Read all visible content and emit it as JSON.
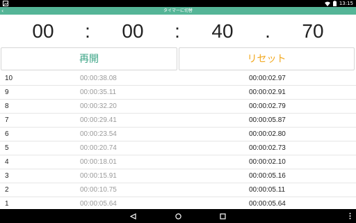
{
  "status_bar": {
    "time": "13:15"
  },
  "app_bar": {
    "title": "タイマーに切替"
  },
  "timer": {
    "hours": "00",
    "sep1": ":",
    "minutes": "00",
    "sep2": ":",
    "seconds": "40",
    "sep3": ".",
    "hundredths": "70"
  },
  "buttons": {
    "resume": "再開",
    "reset": "リセット"
  },
  "laps": [
    {
      "no": "10",
      "total": "00:00:38.08",
      "split": "00:00:02.97"
    },
    {
      "no": "9",
      "total": "00:00:35.11",
      "split": "00:00:02.91"
    },
    {
      "no": "8",
      "total": "00:00:32.20",
      "split": "00:00:02.79"
    },
    {
      "no": "7",
      "total": "00:00:29.41",
      "split": "00:00:05.87"
    },
    {
      "no": "6",
      "total": "00:00:23.54",
      "split": "00:00:02.80"
    },
    {
      "no": "5",
      "total": "00:00:20.74",
      "split": "00:00:02.73"
    },
    {
      "no": "4",
      "total": "00:00:18.01",
      "split": "00:00:02.10"
    },
    {
      "no": "3",
      "total": "00:00:15.91",
      "split": "00:00:05.16"
    },
    {
      "no": "2",
      "total": "00:00:10.75",
      "split": "00:00:05.11"
    },
    {
      "no": "1",
      "total": "00:00:05.64",
      "split": "00:00:05.64"
    }
  ],
  "colors": {
    "app_bar": "#55b597",
    "resume": "#3aa385",
    "reset": "#f2a81e"
  },
  "icons": {
    "back": "chevron-left-icon",
    "nav_back": "triangle-back-icon",
    "nav_home": "circle-home-icon",
    "nav_recents": "square-recents-icon",
    "overflow": "more-vert-icon"
  }
}
